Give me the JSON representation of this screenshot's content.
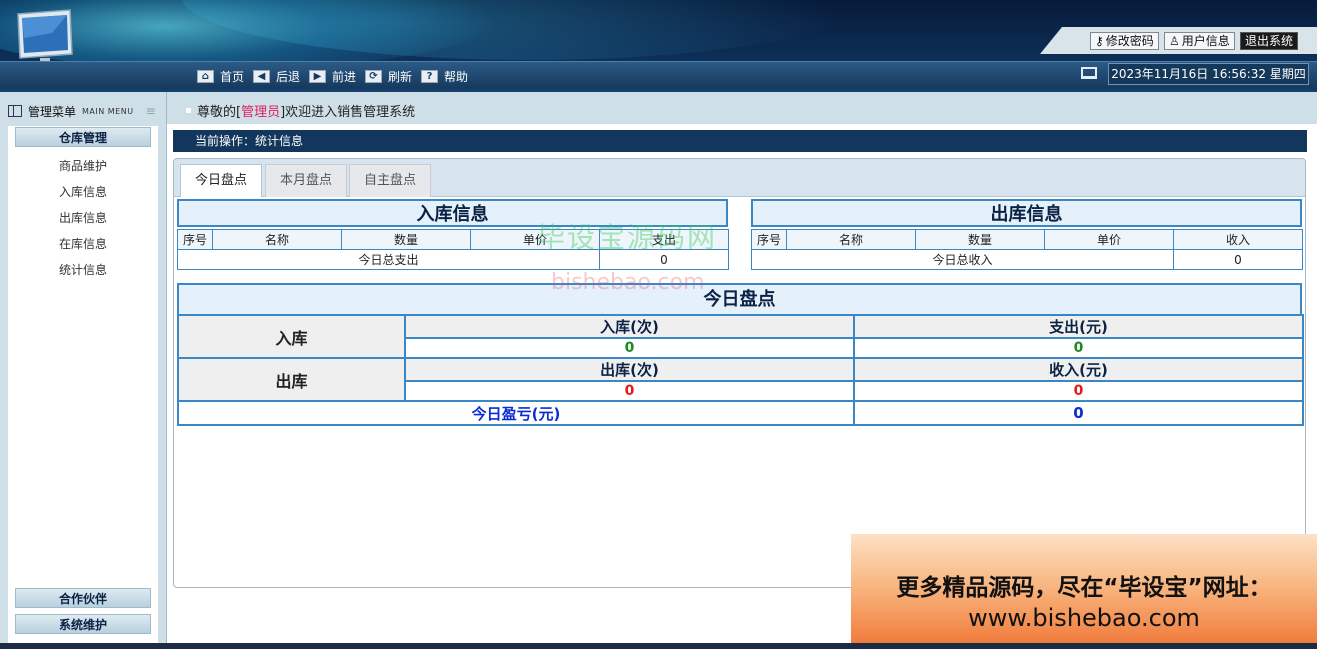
{
  "header": {
    "links": {
      "change_password": "修改密码",
      "user_info": "用户信息",
      "logout": "退出系统"
    },
    "nav": [
      {
        "label": "首页",
        "icon": "home-icon"
      },
      {
        "label": "后退",
        "icon": "arrow-left-icon"
      },
      {
        "label": "前进",
        "icon": "arrow-right-icon"
      },
      {
        "label": "刷新",
        "icon": "refresh-icon"
      },
      {
        "label": "帮助",
        "icon": "help-icon"
      }
    ],
    "datetime": "2023年11月16日 16:56:32 星期四"
  },
  "sidebar": {
    "title": "管理菜单",
    "subtitle": "MAIN MENU",
    "groups": [
      {
        "title": "仓库管理",
        "items": [
          "商品维护",
          "入库信息",
          "出库信息",
          "在库信息",
          "统计信息"
        ]
      },
      {
        "title": "合作伙伴"
      },
      {
        "title": "系统维护"
      }
    ]
  },
  "welcome": {
    "prefix": "尊敬的[ ",
    "role": "管理员",
    "suffix": " ]欢迎进入销售管理系统"
  },
  "main": {
    "current_op": "当前操作：统计信息",
    "tabs": [
      "今日盘点",
      "本月盘点",
      "自主盘点"
    ],
    "inbound": {
      "title": "入库信息",
      "headers": [
        "序号",
        "名称",
        "数量",
        "单价",
        "支出"
      ],
      "total_label": "今日总支出",
      "total_value": "0"
    },
    "outbound": {
      "title": "出库信息",
      "headers": [
        "序号",
        "名称",
        "数量",
        "单价",
        "收入"
      ],
      "total_label": "今日总收入",
      "total_value": "0"
    },
    "summary": {
      "title": "今日盘点",
      "in_label": "入库",
      "in_count_label": "入库(次)",
      "in_count": "0",
      "expense_label": "支出(元)",
      "expense": "0",
      "out_label": "出库",
      "out_count_label": "出库(次)",
      "out_count": "0",
      "income_label": "收入(元)",
      "income": "0",
      "profit_label": "今日盈亏(元)",
      "profit": "0"
    }
  },
  "watermark": {
    "site_cn": "毕设宝源码网",
    "site_domain": "bishebao.com"
  },
  "ad": {
    "line1": "更多精品源码，尽在“毕设宝”网址：",
    "line2": "www.bishebao.com"
  },
  "colors": {
    "header_dark": "#0c2b52",
    "table_border": "#3b86c4",
    "green_value": "#1c8a1c",
    "red_value": "#e21a1a",
    "blue_value": "#0a2bd6",
    "role_highlight": "#e02060"
  }
}
